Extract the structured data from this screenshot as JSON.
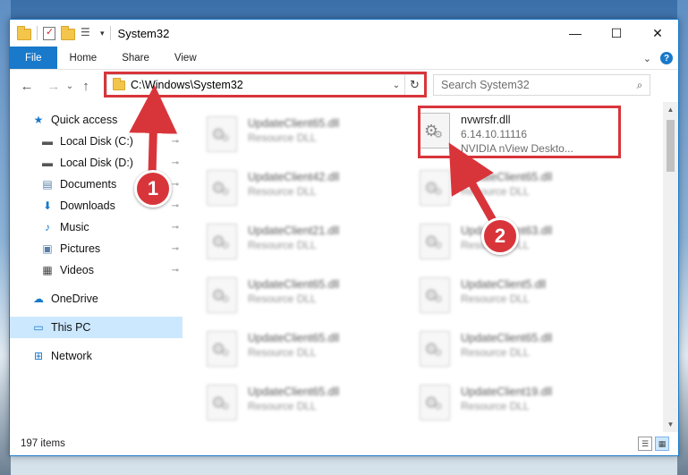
{
  "window": {
    "title": "System32",
    "buttons": {
      "minimize": "—",
      "maximize": "☐",
      "close": "✕"
    }
  },
  "ribbon": {
    "tabs": [
      {
        "label": "File"
      },
      {
        "label": "Home"
      },
      {
        "label": "Share"
      },
      {
        "label": "View"
      }
    ],
    "expand": "⌄",
    "help": "?"
  },
  "navigation": {
    "back": "←",
    "forward": "→",
    "recent": "⌄",
    "up": "↑"
  },
  "address": {
    "path": "C:\\Windows\\System32",
    "dropdown": "⌄",
    "refresh": "↻"
  },
  "search": {
    "placeholder": "Search System32",
    "icon": "⌕"
  },
  "sidebar": {
    "items": [
      {
        "label": "Quick access",
        "icon": "star-icon",
        "glyph": "★",
        "color": "#1979ca",
        "indent": 0
      },
      {
        "label": "Local Disk (C:)",
        "icon": "drive-icon",
        "glyph": "▬",
        "color": "#555555",
        "indent": 1,
        "pinned": true
      },
      {
        "label": "Local Disk (D:)",
        "icon": "drive-icon",
        "glyph": "▬",
        "color": "#555555",
        "indent": 1,
        "pinned": true
      },
      {
        "label": "Documents",
        "icon": "documents-icon",
        "glyph": "▤",
        "color": "#5a7ea8",
        "indent": 1,
        "pinned": true
      },
      {
        "label": "Downloads",
        "icon": "downloads-icon",
        "glyph": "⬇",
        "color": "#1979ca",
        "indent": 1,
        "pinned": true
      },
      {
        "label": "Music",
        "icon": "music-icon",
        "glyph": "♪",
        "color": "#1979ca",
        "indent": 1,
        "pinned": true
      },
      {
        "label": "Pictures",
        "icon": "pictures-icon",
        "glyph": "▣",
        "color": "#5a7ea8",
        "indent": 1,
        "pinned": true
      },
      {
        "label": "Videos",
        "icon": "videos-icon",
        "glyph": "▦",
        "color": "#444444",
        "indent": 1,
        "pinned": true
      },
      {
        "label": "OneDrive",
        "icon": "onedrive-icon",
        "glyph": "☁",
        "color": "#1979ca",
        "indent": 0,
        "gapBefore": true
      },
      {
        "label": "This PC",
        "icon": "this-pc-icon",
        "glyph": "▭",
        "color": "#1979ca",
        "indent": 0,
        "gapBefore": true,
        "selected": true
      },
      {
        "label": "Network",
        "icon": "network-icon",
        "glyph": "⊞",
        "color": "#1979ca",
        "indent": 0,
        "gapBefore": true
      }
    ],
    "pin_glyph": "📌"
  },
  "files": {
    "highlighted": {
      "name": "nvwrsfr.dll",
      "version": "6.14.10.11116",
      "description": "NVIDIA nView Deskto..."
    },
    "left_column": [
      {
        "name": "UpdateClient65.dll",
        "type": "Resource DLL"
      },
      {
        "name": "UpdateClient42.dll",
        "type": "Resource DLL"
      },
      {
        "name": "UpdateClient21.dll",
        "type": "Resource DLL"
      },
      {
        "name": "UpdateClient65.dll",
        "type": "Resource DLL"
      },
      {
        "name": "UpdateClient65.dll",
        "type": "Resource DLL"
      },
      {
        "name": "UpdateClient65.dll",
        "type": "Resource DLL"
      }
    ],
    "right_column": [
      {
        "name": "UpdateClient65.dll",
        "type": "Resource DLL"
      },
      {
        "name": "UpdateClient63.dll",
        "type": "Resource DLL"
      },
      {
        "name": "UpdateClient5.dll",
        "type": "Resource DLL"
      },
      {
        "name": "UpdateClient65.dll",
        "type": "Resource DLL"
      },
      {
        "name": "UpdateClient19.dll",
        "type": "Resource DLL"
      }
    ]
  },
  "status": {
    "count": "197 items"
  },
  "annotations": {
    "step1": "1",
    "step2": "2",
    "color": "#d8353b"
  }
}
